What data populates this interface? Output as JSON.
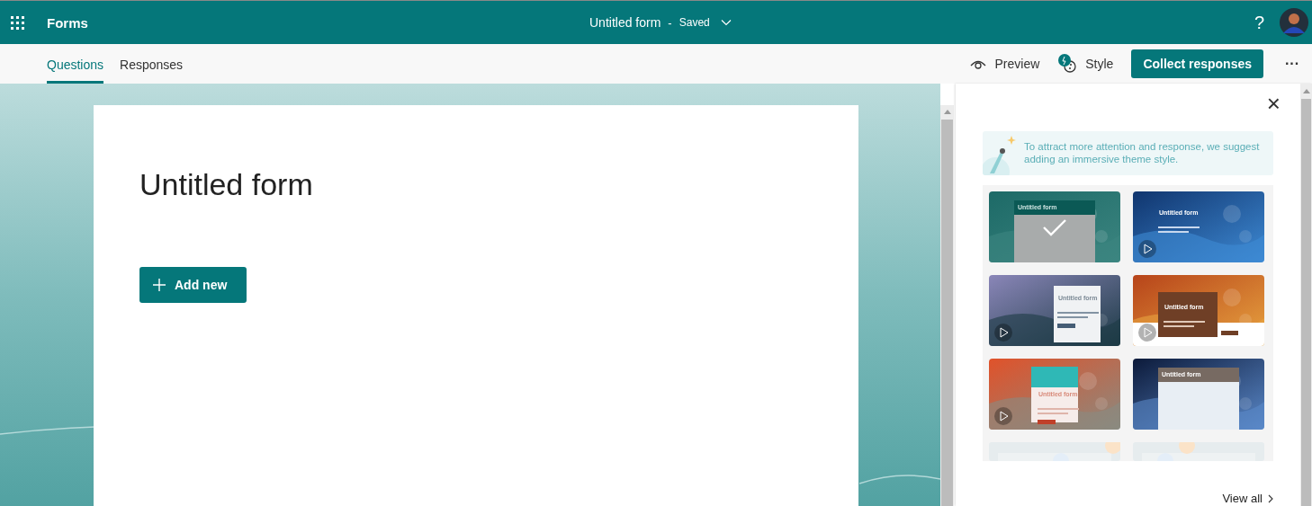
{
  "header": {
    "app_name": "Forms",
    "form_title": "Untitled form",
    "separator": "-",
    "save_state": "Saved",
    "help": "?"
  },
  "tabs": [
    {
      "label": "Questions",
      "selected": true
    },
    {
      "label": "Responses",
      "selected": false
    }
  ],
  "toolbar": {
    "preview": "Preview",
    "style": "Style",
    "collect": "Collect responses",
    "more": "···"
  },
  "form": {
    "title": "Untitled form",
    "add_button": "Add new"
  },
  "style_panel": {
    "close": "×",
    "tip": "To attract more attention and response, we suggest adding an immersive theme style.",
    "themes": [
      {
        "title": "Untitled form",
        "selected": true,
        "video": false
      },
      {
        "title": "Untitled form",
        "selected": false,
        "video": true
      },
      {
        "title": "Untitled form",
        "selected": false,
        "video": true
      },
      {
        "title": "Untitled form",
        "selected": false,
        "video": true
      },
      {
        "title": "Untitled form",
        "selected": false,
        "video": true
      },
      {
        "title": "Untitled form",
        "selected": false,
        "video": false
      }
    ],
    "view_all": "View all"
  }
}
